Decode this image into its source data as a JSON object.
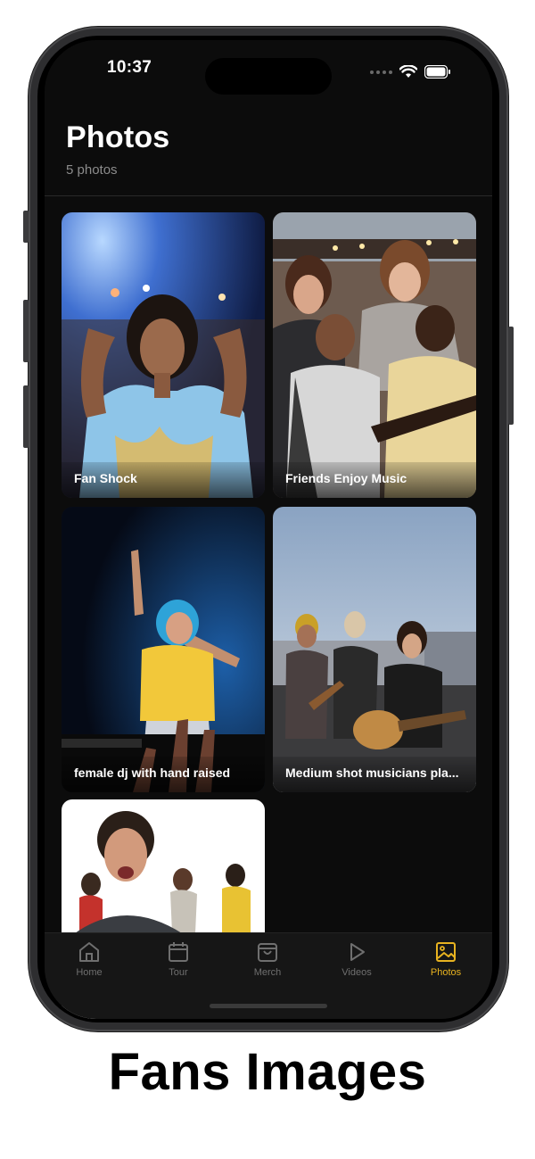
{
  "status_bar": {
    "time": "10:37"
  },
  "header": {
    "title": "Photos",
    "subtitle": "5 photos"
  },
  "photos": [
    {
      "caption": "Fan Shock"
    },
    {
      "caption": "Friends Enjoy Music"
    },
    {
      "caption": "female dj with hand raised"
    },
    {
      "caption": "Medium shot musicians pla..."
    },
    {
      "caption": ""
    }
  ],
  "tabs": [
    {
      "label": "Home",
      "icon": "home-icon"
    },
    {
      "label": "Tour",
      "icon": "calendar-icon"
    },
    {
      "label": "Merch",
      "icon": "shopping-bag-icon"
    },
    {
      "label": "Videos",
      "icon": "play-icon"
    },
    {
      "label": "Photos",
      "icon": "image-icon",
      "active": true
    }
  ],
  "colors": {
    "accent": "#e8b320",
    "background": "#0c0c0c",
    "tab_inactive": "#6f6f6f"
  },
  "footer_caption": "Fans Images"
}
